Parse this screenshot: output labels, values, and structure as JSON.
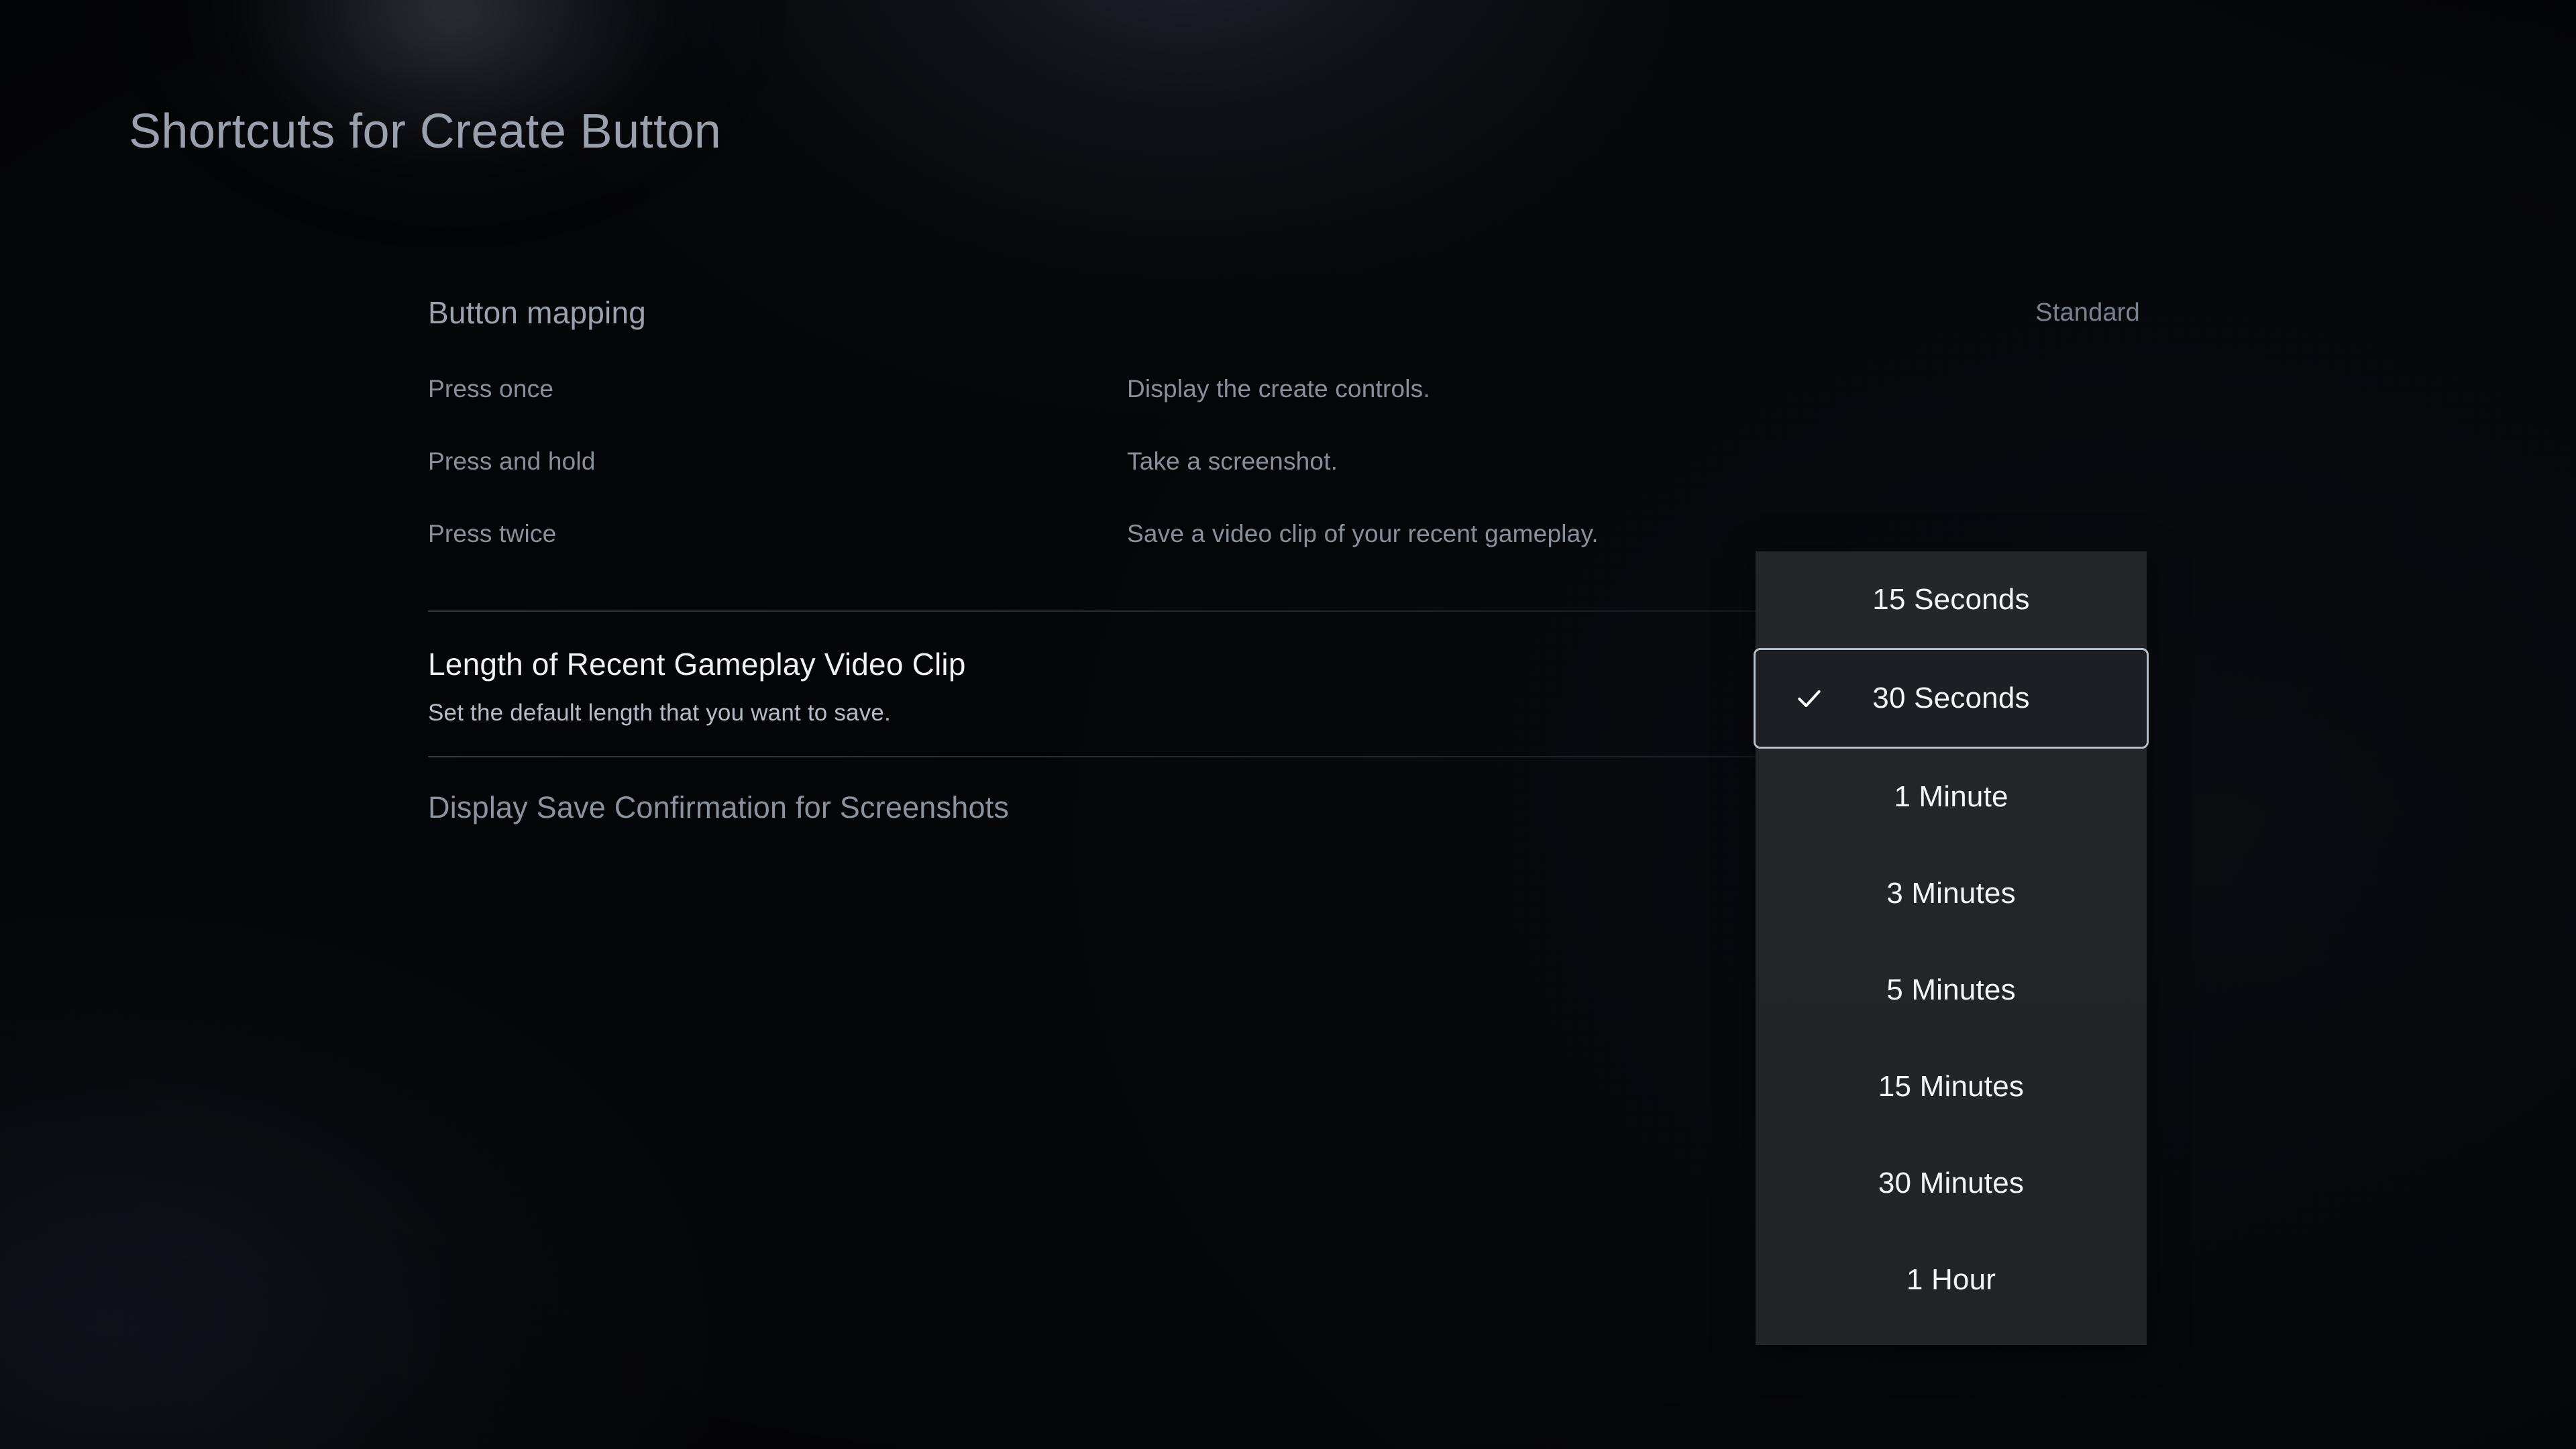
{
  "page": {
    "title": "Shortcuts for Create Button"
  },
  "button_mapping": {
    "label": "Button mapping",
    "value": "Standard",
    "rows": [
      {
        "action": "Press once",
        "description": "Display the create controls."
      },
      {
        "action": "Press and hold",
        "description": "Take a screenshot."
      },
      {
        "action": "Press twice",
        "description": "Save a video clip of your recent gameplay."
      }
    ]
  },
  "clip_length": {
    "title": "Length of Recent Gameplay Video Clip",
    "subtitle": "Set the default length that you want to save."
  },
  "save_confirmation": {
    "label": "Display Save Confirmation for Screenshots"
  },
  "dropdown": {
    "selected": "30 Seconds",
    "check_icon": "check-icon",
    "options": [
      {
        "label": "15 Seconds",
        "selected": false
      },
      {
        "label": "30 Seconds",
        "selected": true
      },
      {
        "label": "1 Minute",
        "selected": false
      },
      {
        "label": "3 Minutes",
        "selected": false
      },
      {
        "label": "5 Minutes",
        "selected": false
      },
      {
        "label": "15 Minutes",
        "selected": false
      },
      {
        "label": "30 Minutes",
        "selected": false
      },
      {
        "label": "1 Hour",
        "selected": false
      }
    ]
  },
  "colors": {
    "background": "#0b0e13",
    "panel": "#24262a",
    "selected_panel": "#1d1f24",
    "selected_border": "#b9bfc9",
    "text_primary": "#eef1f5",
    "text_secondary": "#8a9099",
    "text_muted": "#7b828e",
    "divider": "#a8b2c4"
  }
}
